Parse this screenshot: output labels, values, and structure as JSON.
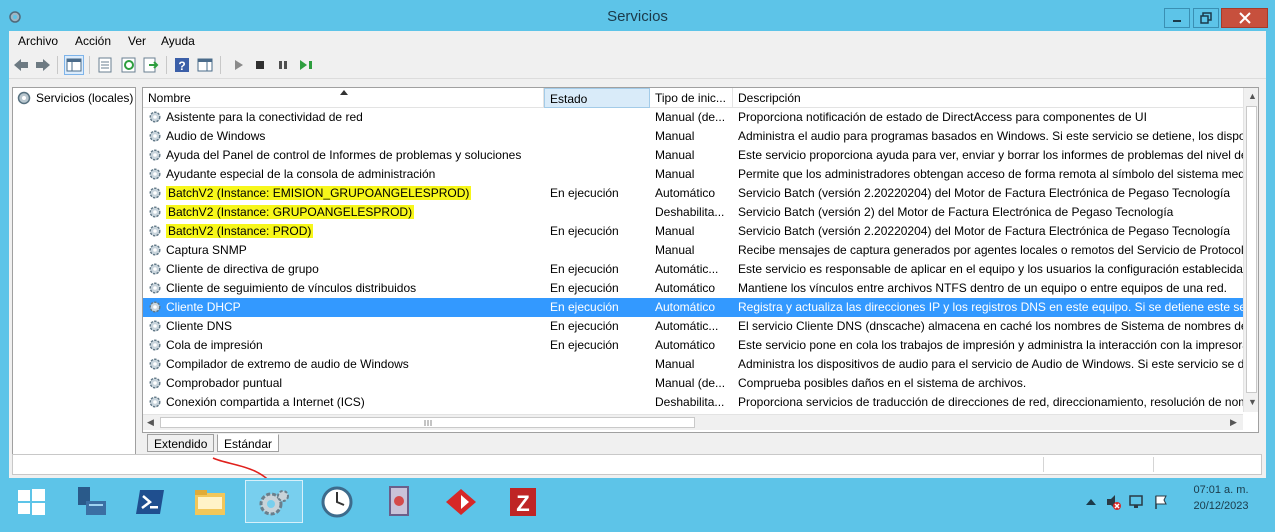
{
  "window": {
    "title": "Servicios"
  },
  "menu": [
    "Archivo",
    "Acción",
    "Ver",
    "Ayuda"
  ],
  "tree": {
    "root_label": "Servicios (locales)"
  },
  "columns": {
    "name": "Nombre",
    "state": "Estado",
    "type": "Tipo de inic...",
    "desc": "Descripción"
  },
  "rows": [
    {
      "name": "Asistente para la conectividad de red",
      "state": "",
      "type": "Manual (de...",
      "desc": "Proporciona notificación de estado de DirectAccess para componentes de UI"
    },
    {
      "name": "Audio de Windows",
      "state": "",
      "type": "Manual",
      "desc": "Administra el audio para programas basados en Windows. Si este servicio se detiene, los disposit"
    },
    {
      "name": "Ayuda del Panel de control de Informes de problemas y soluciones",
      "state": "",
      "type": "Manual",
      "desc": "Este servicio proporciona ayuda para ver, enviar y borrar los informes de problemas del nivel de s"
    },
    {
      "name": "Ayudante especial de la consola de administración",
      "state": "",
      "type": "Manual",
      "desc": "Permite que los administradores obtengan acceso de forma remota al símbolo del sistema medi"
    },
    {
      "name": "BatchV2 (Instance: EMISION_GRUPOANGELESPROD)",
      "state": "En ejecución",
      "type": "Automático",
      "desc": "Servicio Batch (versión 2.20220204) del Motor de Factura Electrónica de Pegaso Tecnología",
      "highlight": true
    },
    {
      "name": "BatchV2 (Instance: GRUPOANGELESPROD)",
      "state": "",
      "type": "Deshabilita...",
      "desc": "Servicio Batch (versión 2) del Motor de Factura Electrónica de Pegaso Tecnología",
      "highlight": true
    },
    {
      "name": "BatchV2 (Instance: PROD)",
      "state": "En ejecución",
      "type": "Manual",
      "desc": "Servicio Batch (versión 2.20220204) del Motor de Factura Electrónica de Pegaso Tecnología",
      "highlight": true
    },
    {
      "name": "Captura SNMP",
      "state": "",
      "type": "Manual",
      "desc": "Recibe mensajes de captura generados por agentes locales o remotos del Servicio de Protocolo s"
    },
    {
      "name": "Cliente de directiva de grupo",
      "state": "En ejecución",
      "type": "Automátic...",
      "desc": "Este servicio es responsable de aplicar en el equipo y los usuarios la configuración establecida po"
    },
    {
      "name": "Cliente de seguimiento de vínculos distribuidos",
      "state": "En ejecución",
      "type": "Automático",
      "desc": "Mantiene los vínculos entre archivos NTFS dentro de un equipo o entre equipos de una red."
    },
    {
      "name": "Cliente DHCP",
      "state": "En ejecución",
      "type": "Automático",
      "desc": "Registra y actualiza las direcciones IP y los registros DNS en este equipo. Si se detiene este servici",
      "selected": true
    },
    {
      "name": "Cliente DNS",
      "state": "En ejecución",
      "type": "Automátic...",
      "desc": "El servicio Cliente DNS (dnscache) almacena en caché los nombres de Sistema de nombres de do"
    },
    {
      "name": "Cola de impresión",
      "state": "En ejecución",
      "type": "Automático",
      "desc": "Este servicio pone en cola los trabajos de impresión y administra la interacción con la impresora."
    },
    {
      "name": "Compilador de extremo de audio de Windows",
      "state": "",
      "type": "Manual",
      "desc": "Administra los dispositivos de audio para el servicio de Audio de Windows. Si este servicio se det"
    },
    {
      "name": "Comprobador puntual",
      "state": "",
      "type": "Manual (de...",
      "desc": "Comprueba posibles daños en el sistema de archivos."
    },
    {
      "name": "Conexión compartida a Internet (ICS)",
      "state": "",
      "type": "Deshabilita...",
      "desc": "Proporciona servicios de traducción de direcciones de red, direccionamiento, resolución de nom"
    }
  ],
  "tabs": {
    "extended": "Extendido",
    "standard": "Estándar"
  },
  "clock": {
    "time": "07:01 a. m.",
    "date": "20/12/2023"
  },
  "taskbar_apps": [
    "start",
    "server-manager",
    "powershell",
    "file-explorer",
    "services",
    "clock-app",
    "remote-app",
    "red-app",
    "filezilla"
  ]
}
